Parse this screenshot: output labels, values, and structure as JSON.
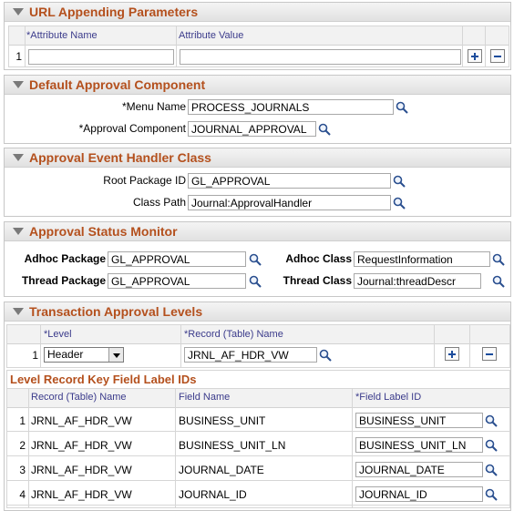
{
  "url_params": {
    "title": "URL Appending Parameters",
    "col_name": "*Attribute Name",
    "col_value": "Attribute Value",
    "row_num": "1",
    "name_value": "",
    "value_value": ""
  },
  "default_approval": {
    "title": "Default Approval Component",
    "menu_label": "*Menu Name",
    "menu_value": "PROCESS_JOURNALS",
    "component_label": "*Approval Component",
    "component_value": "JOURNAL_APPROVAL"
  },
  "event_handler": {
    "title": "Approval Event Handler Class",
    "root_label": "Root Package ID",
    "root_value": "GL_APPROVAL",
    "path_label": "Class Path",
    "path_value": "Journal:ApprovalHandler"
  },
  "status_monitor": {
    "title": "Approval Status Monitor",
    "adhoc_pkg_label": "Adhoc Package",
    "adhoc_pkg_value": "GL_APPROVAL",
    "adhoc_class_label": "Adhoc Class",
    "adhoc_class_value": "RequestInformation",
    "thread_pkg_label": "Thread Package",
    "thread_pkg_value": "GL_APPROVAL",
    "thread_class_label": "Thread Class",
    "thread_class_value": "Journal:threadDescr"
  },
  "levels": {
    "title": "Transaction Approval Levels",
    "col_level": "*Level",
    "col_record": "*Record (Table) Name",
    "row_num": "1",
    "level_value": "Header",
    "record_value": "JRNL_AF_HDR_VW"
  },
  "key_fields": {
    "title": "Level Record Key Field Label IDs",
    "col_record": "Record (Table) Name",
    "col_field": "Field Name",
    "col_label": "*Field Label ID",
    "rows": [
      {
        "num": "1",
        "record": "JRNL_AF_HDR_VW",
        "field": "BUSINESS_UNIT",
        "label": "BUSINESS_UNIT"
      },
      {
        "num": "2",
        "record": "JRNL_AF_HDR_VW",
        "field": "BUSINESS_UNIT_LN",
        "label": "BUSINESS_UNIT_LN"
      },
      {
        "num": "3",
        "record": "JRNL_AF_HDR_VW",
        "field": "JOURNAL_DATE",
        "label": "JOURNAL_DATE"
      },
      {
        "num": "4",
        "record": "JRNL_AF_HDR_VW",
        "field": "JOURNAL_ID",
        "label": "JOURNAL_ID"
      }
    ]
  }
}
